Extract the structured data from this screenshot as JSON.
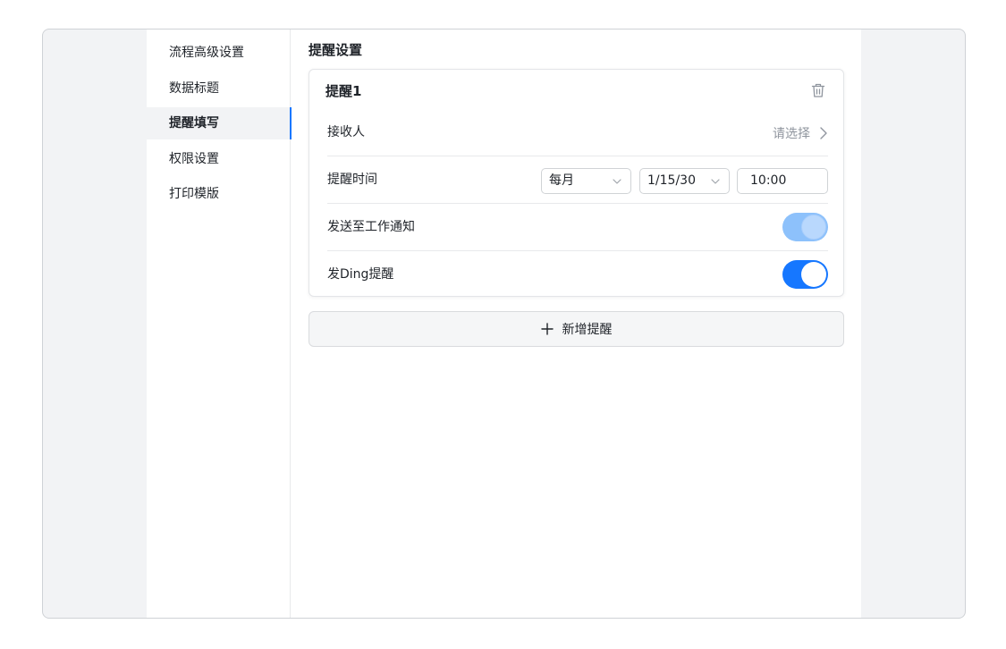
{
  "sidebar": {
    "items": [
      {
        "label": "流程高级设置"
      },
      {
        "label": "数据标题"
      },
      {
        "label": "提醒填写"
      },
      {
        "label": "权限设置"
      },
      {
        "label": "打印模版"
      }
    ],
    "active_index": 2
  },
  "main": {
    "section_title": "提醒设置",
    "reminder": {
      "title": "提醒1",
      "delete_icon": "trash-icon",
      "recipient": {
        "label": "接收人",
        "placeholder": "请选择"
      },
      "time": {
        "label": "提醒时间",
        "frequency": "每月",
        "date": "1/15/30",
        "clock": "10:00"
      },
      "work_notice": {
        "label": "发送至工作通知",
        "enabled": true,
        "disabled": true
      },
      "ding": {
        "label": "发Ding提醒",
        "enabled": true
      }
    },
    "add_button": {
      "icon": "plus-icon",
      "label": "新增提醒"
    }
  },
  "colors": {
    "accent": "#1677ff",
    "accent_disabled": "#8dc1fb",
    "frame_bg": "#f2f3f5",
    "border": "#e8e9eb"
  }
}
